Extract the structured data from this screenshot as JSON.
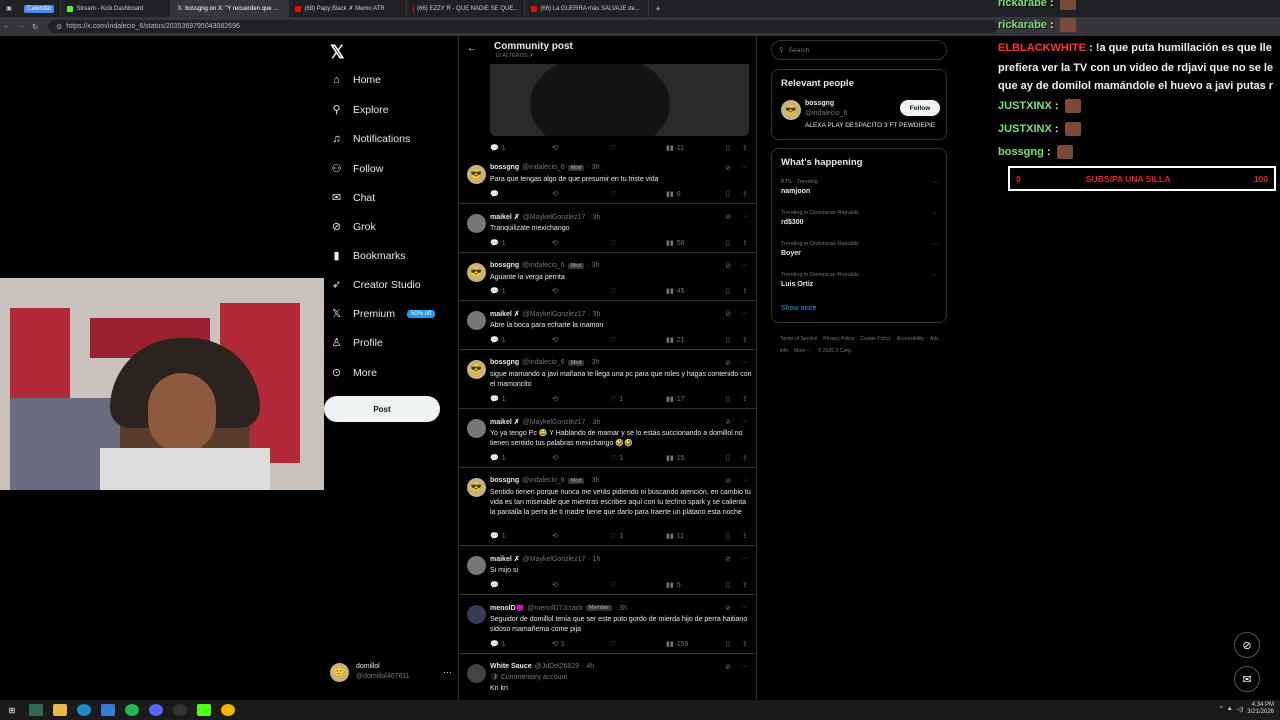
{
  "browser": {
    "tabs": [
      {
        "label": "Calendar",
        "pill": true,
        "color": "#4a8af4"
      },
      {
        "label": "Stream - Kick Dashboard",
        "color": "#53fc18"
      },
      {
        "label": "bossgng on X: \"Y recuerden que ...",
        "color": "#ffffff",
        "active": true
      },
      {
        "label": "(68) Papy Black ✗ Memo ATR",
        "color": "#ff0000"
      },
      {
        "label": "(66) EZZY R - QUE NADIE SE QUE...",
        "color": "#ff0000"
      },
      {
        "label": "(66) La GUERRA más SALVAJE de...",
        "color": "#ff0000"
      }
    ],
    "url": "https://x.com/indalecio_6/status/2035369795043082696"
  },
  "xnav": {
    "items": [
      {
        "label": "Home",
        "icon": "home-icon",
        "glyph": "⌂"
      },
      {
        "label": "Explore",
        "icon": "search-icon",
        "glyph": "⚲"
      },
      {
        "label": "Notifications",
        "icon": "bell-icon",
        "glyph": "♫"
      },
      {
        "label": "Follow",
        "icon": "person-add-icon",
        "glyph": "⚇"
      },
      {
        "label": "Chat",
        "icon": "mail-icon",
        "glyph": "✉"
      },
      {
        "label": "Grok",
        "icon": "grok-icon",
        "glyph": "⊘"
      },
      {
        "label": "Bookmarks",
        "icon": "bookmark-icon",
        "glyph": "▮"
      },
      {
        "label": "Creator Studio",
        "icon": "rocket-icon",
        "glyph": "➶"
      },
      {
        "label": "Premium",
        "icon": "x-icon",
        "glyph": "𝕏"
      },
      {
        "label": "Profile",
        "icon": "person-icon",
        "glyph": "♙"
      },
      {
        "label": "More",
        "icon": "more-circle-icon",
        "glyph": "⊙"
      }
    ],
    "premium_badge": "50% off",
    "post_label": "Post",
    "user": {
      "name": "domillol",
      "handle": "@domillol467611"
    }
  },
  "main": {
    "title": "Community post",
    "subtitle": "16 ALTEROS ✗",
    "top_actions": {
      "replies": "1",
      "likes": "",
      "views": "11"
    },
    "replies": [
      {
        "name": "bossgng",
        "handle": "@indalecio_6",
        "badge": "Mod",
        "time": "· 3h",
        "text": "Para que tengas algo de que presumir en tu triste vida",
        "replies": "",
        "reposts": "",
        "likes": "",
        "views": "6"
      },
      {
        "name": "maikel ✗",
        "handle": "@MaykelGonzlez17",
        "badge": "",
        "time": "· 3h",
        "text": "Tranquilizate mexichango",
        "replies": "1",
        "reposts": "",
        "likes": "",
        "views": "56"
      },
      {
        "name": "bossgng",
        "handle": "@indalecio_6",
        "badge": "Mod",
        "time": "· 3h",
        "text": "Aguante la verga perrita",
        "replies": "1",
        "reposts": "",
        "likes": "",
        "views": "45"
      },
      {
        "name": "maikel ✗",
        "handle": "@MaykelGonzlez17",
        "badge": "",
        "time": "· 3h",
        "text": "Abre la boca para echarte la mamon",
        "replies": "1",
        "reposts": "",
        "likes": "",
        "views": "21"
      },
      {
        "name": "bossgng",
        "handle": "@indalecio_6",
        "badge": "Mod",
        "time": "· 3h",
        "text": "sigue mamando a javi mañana te llega una pc para que roles y hagas contenido con el mamoncito",
        "replies": "1",
        "reposts": "",
        "likes": "1",
        "views": "17"
      },
      {
        "name": "maikel ✗",
        "handle": "@MaykelGonzlez17",
        "badge": "",
        "time": "· 3h",
        "text": "Yo ya tengo Pc 😂 Y Hablando de mamar y se lo estás succionando a domillol no tienen sentido tus palabras mexichango 🤣🤣",
        "replies": "1",
        "reposts": "",
        "likes": "1",
        "views": "15"
      },
      {
        "name": "bossgng",
        "handle": "@indalecio_6",
        "badge": "Mod",
        "time": "· 3h",
        "text": "Sentido tienen porque nunca me verás pidiendo ni buscando atención, en cambio tu vida es tan miserable que mientras escribes aquí con tu techno spark y se calienta la pantalla la perra de ti madre tiene que darlo para traerte un plátano esta noche",
        "replies": "1",
        "reposts": "",
        "likes": "1",
        "views": "11"
      },
      {
        "name": "maikel ✗",
        "handle": "@MaykelGonzlez17",
        "badge": "",
        "time": "· 1h",
        "text": "Si mijo si",
        "replies": "",
        "reposts": "",
        "likes": "",
        "views": "5"
      },
      {
        "name": "menolD😈",
        "handle": "@menolD7Jcrack",
        "badge": "Member",
        "time": "· 3h",
        "text": "Seguidor de domillol tenía que ser este puto gordo de mierda hijo de perra haitiano sidoso mamañema come pija",
        "replies": "1",
        "reposts": "1",
        "likes": "",
        "views": "159"
      },
      {
        "name": "White Sauce",
        "handle": "@JdDel26829",
        "badge": "",
        "time": "· 4h",
        "text": "Kri kri",
        "replies": "",
        "reposts": "",
        "likes": "",
        "views": "",
        "commentary": "Commentary account"
      }
    ]
  },
  "right": {
    "search_placeholder": "Search",
    "relevant_title": "Relevant people",
    "relevant": {
      "name": "bossgng",
      "handle": "@indalecio_6",
      "bio": "ALEXA PLAY DESPACITO 3 FT PEWDIEPIE",
      "follow_label": "Follow"
    },
    "happening_title": "What's happening",
    "trends": [
      {
        "context": "BTS · Trending",
        "name": "namjoon"
      },
      {
        "context": "Trending in Dominican Republic",
        "name": "rd$300"
      },
      {
        "context": "Trending in Dominican Republic",
        "name": "Boyer"
      },
      {
        "context": "Trending in Dominican Republic",
        "name": "Luis Ortiz"
      }
    ],
    "show_more": "Show more",
    "footer": [
      "Terms of Service",
      "Privacy Policy",
      "Cookie Policy",
      "Accessibility",
      "Ads info",
      "More ···",
      "© 2026 X Corp."
    ]
  },
  "chat": {
    "lines": [
      {
        "user": "rickarabe",
        "sep": " : ",
        "msg": "",
        "color": "green",
        "emote": true
      },
      {
        "user": "rickarabe",
        "sep": " : ",
        "msg": "",
        "color": "green",
        "emote": true
      },
      {
        "user": "ELBLACKWHITE",
        "sep": " : ",
        "msg": "!a que puta humillación es que lle",
        "color": "red",
        "emote": false
      },
      {
        "user": "",
        "sep": "",
        "msg": "prefiera ver la TV con un video de rdjavi que no se le",
        "color": "none",
        "emote": false
      },
      {
        "user": "",
        "sep": "",
        "msg": "que ay de domilol mamándole el huevo a javi putas r",
        "color": "none",
        "emote": false
      },
      {
        "user": "JUSTXINX",
        "sep": " : ",
        "msg": "",
        "color": "green",
        "emote": true
      },
      {
        "user": "JUSTXINX",
        "sep": " : ",
        "msg": "",
        "color": "green",
        "emote": true
      },
      {
        "user": "bossgng",
        "sep": " : ",
        "msg": "",
        "color": "green",
        "emote": true
      }
    ],
    "goal": {
      "start": "0",
      "label": "SUBS/PA UNA SILLA",
      "end": "100"
    }
  },
  "taskbar": {
    "time": "4:34 PM",
    "date": "3/21/2026"
  },
  "colors": {
    "accent": "#1d9bf0",
    "background": "#000000",
    "chat_green": "#7de07d",
    "chat_red": "#ff3333"
  }
}
